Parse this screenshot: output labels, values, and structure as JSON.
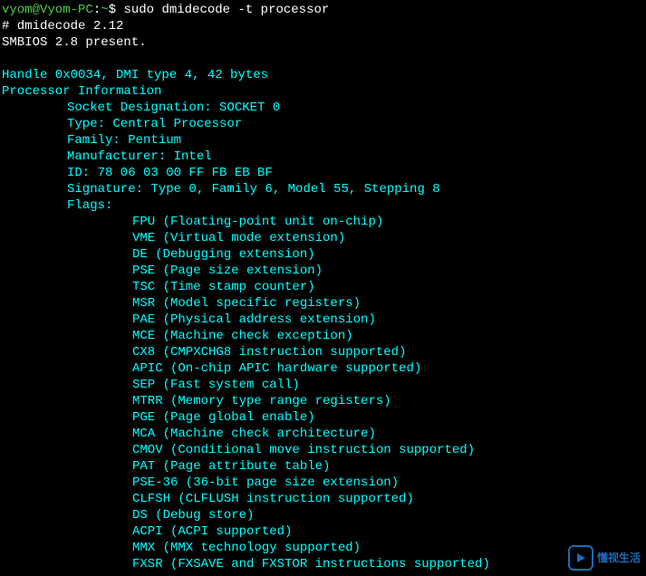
{
  "prompt": {
    "user": "vyom@Vyom-PC",
    "path": "~",
    "sep": ":",
    "dollar": "$",
    "command": "sudo dmidecode -t processor"
  },
  "lines": {
    "comment": "# dmidecode 2.12",
    "smbios": "SMBIOS 2.8 present.",
    "handle": "Handle 0x0034, DMI type 4, 42 bytes",
    "header": "Processor Information"
  },
  "fields": [
    "Socket Designation: SOCKET 0",
    "Type: Central Processor",
    "Family: Pentium",
    "Manufacturer: Intel",
    "ID: 78 06 03 00 FF FB EB BF",
    "Signature: Type 0, Family 6, Model 55, Stepping 8",
    "Flags:"
  ],
  "flags": [
    "FPU (Floating-point unit on-chip)",
    "VME (Virtual mode extension)",
    "DE (Debugging extension)",
    "PSE (Page size extension)",
    "TSC (Time stamp counter)",
    "MSR (Model specific registers)",
    "PAE (Physical address extension)",
    "MCE (Machine check exception)",
    "CX8 (CMPXCHG8 instruction supported)",
    "APIC (On-chip APIC hardware supported)",
    "SEP (Fast system call)",
    "MTRR (Memory type range registers)",
    "PGE (Page global enable)",
    "MCA (Machine check architecture)",
    "CMOV (Conditional move instruction supported)",
    "PAT (Page attribute table)",
    "PSE-36 (36-bit page size extension)",
    "CLFSH (CLFLUSH instruction supported)",
    "DS (Debug store)",
    "ACPI (ACPI supported)",
    "MMX (MMX technology supported)",
    "FXSR (FXSAVE and FXSTOR instructions supported)"
  ],
  "watermark": {
    "text": "懂视生活"
  }
}
